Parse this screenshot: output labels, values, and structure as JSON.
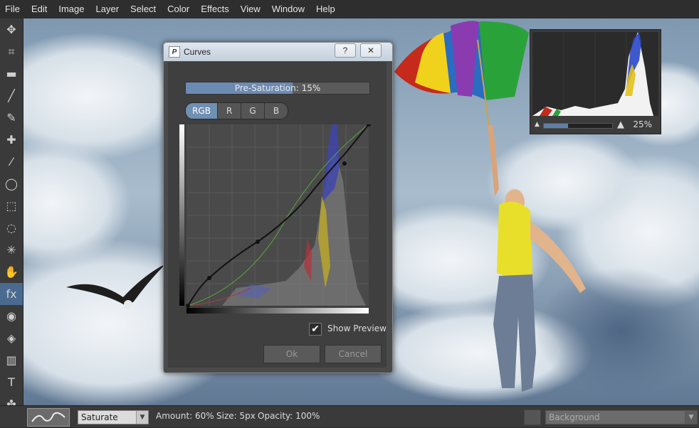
{
  "menu": [
    "File",
    "Edit",
    "Image",
    "Layer",
    "Select",
    "Color",
    "Effects",
    "View",
    "Window",
    "Help"
  ],
  "toolbar": {
    "tools": [
      {
        "name": "move-tool-icon",
        "glyph": "✥"
      },
      {
        "name": "crop-tool-icon",
        "glyph": "⌗"
      },
      {
        "name": "eraser-tool-icon",
        "glyph": "▬"
      },
      {
        "name": "brush-tool-icon",
        "glyph": "╱"
      },
      {
        "name": "pencil-tool-icon",
        "glyph": "✎"
      },
      {
        "name": "clone-stamp-tool-icon",
        "glyph": "✚"
      },
      {
        "name": "dropper-tool-icon",
        "glyph": "⁄"
      },
      {
        "name": "lasso-tool-icon",
        "glyph": "◯"
      },
      {
        "name": "marquee-rect-tool-icon",
        "glyph": "⬚"
      },
      {
        "name": "marquee-ellipse-tool-icon",
        "glyph": "◌"
      },
      {
        "name": "magic-wand-tool-icon",
        "glyph": "✳"
      },
      {
        "name": "smudge-tool-icon",
        "glyph": "✋"
      },
      {
        "name": "effects-brush-tool-icon",
        "glyph": "fx",
        "active": true
      },
      {
        "name": "red-eye-tool-icon",
        "glyph": "◉"
      },
      {
        "name": "fill-tool-icon",
        "glyph": "◈"
      },
      {
        "name": "gradient-tool-icon",
        "glyph": "▥"
      },
      {
        "name": "text-tool-icon",
        "glyph": "T"
      },
      {
        "name": "shape-tool-icon",
        "glyph": "✤"
      }
    ]
  },
  "histogram": {
    "zoom": "25%",
    "zoom_fraction": 0.35
  },
  "curves": {
    "title": "Curves",
    "help_btn": "?",
    "close_btn": "☒",
    "progress_label": "Pre-Saturation: 15%",
    "progress_fraction": 0.58,
    "channels": [
      "RGB",
      "R",
      "G",
      "B"
    ],
    "selected_channel": "RGB",
    "show_preview_checked": true,
    "show_preview_label": "Show Preview",
    "ok_label": "Ok",
    "cancel_label": "Cancel"
  },
  "status": {
    "mode": "Saturate",
    "amount": "Amount: 60%",
    "size": "Size: 5px",
    "opacity": "Opacity: 100%",
    "layer": "Background"
  }
}
